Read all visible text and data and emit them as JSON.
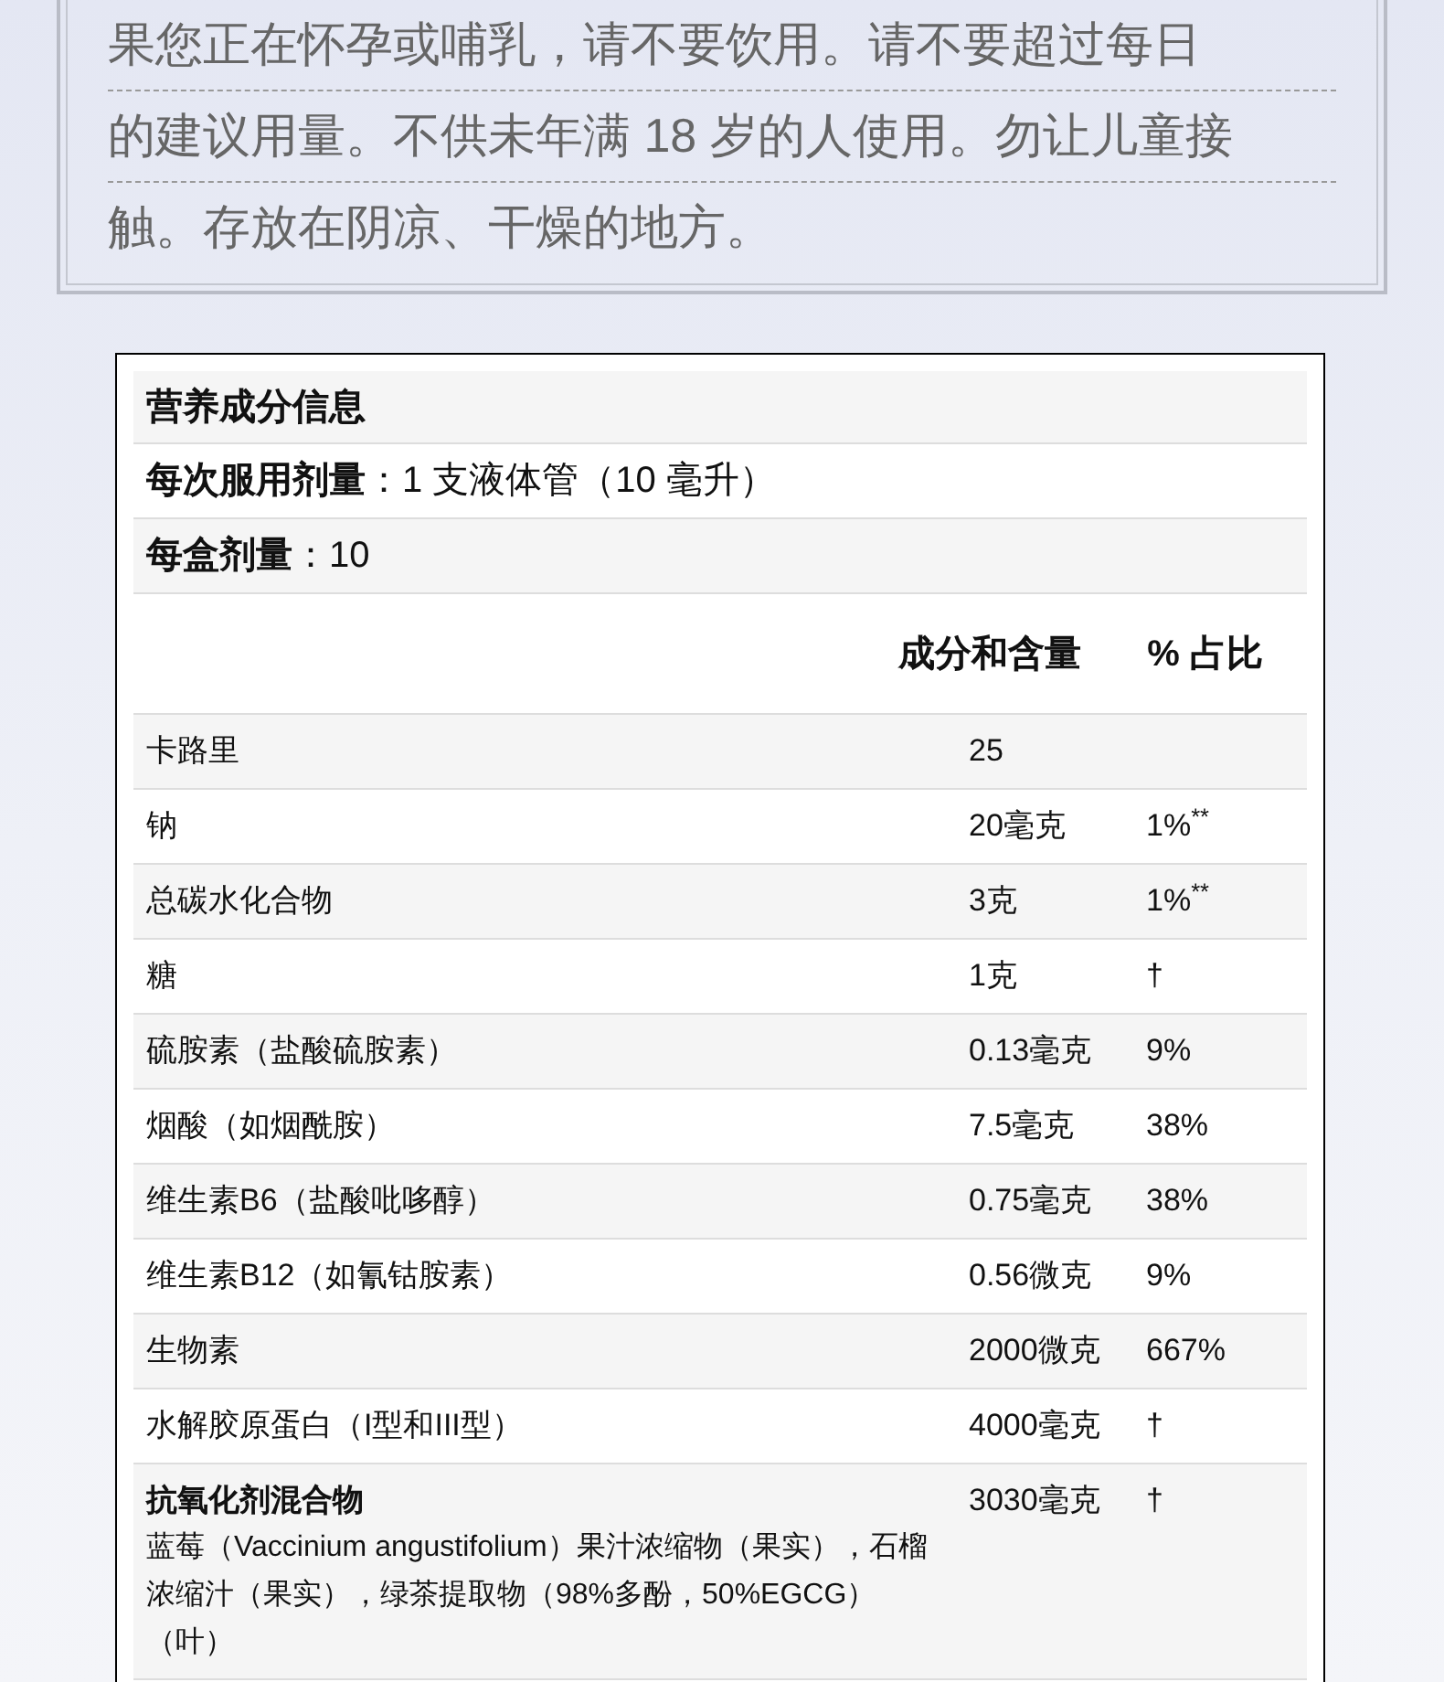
{
  "warning_lines": [
    "果您正在怀孕或哺乳，请不要饮用。请不要超过每日",
    "的建议用量。不供未年满 18 岁的人使用。勿让儿童接",
    "触。存放在阴凉、干燥的地方。"
  ],
  "facts": {
    "title": "营养成分信息",
    "serving_size": "**每次服用剂量**：1 支液体管（10 毫升）",
    "servings_per_box": "**每盒剂量**：10",
    "columns": [
      "成分和含量",
      "% 占比"
    ],
    "rows": [
      {
        "name": "卡路里",
        "amount": "25"
      },
      {
        "name": "钠",
        "amount": "20毫克",
        "percent": "1%$^{**}$"
      },
      {
        "name": "总碳水化合物",
        "amount": "3克",
        "percent": "1%$^{**}$"
      },
      {
        "name": "糖",
        "amount": "1克",
        "percent": "†"
      },
      {
        "name": "硫胺素（盐酸硫胺素）",
        "amount": "0.13毫克",
        "percent": "9%"
      },
      {
        "name": "烟酸（如烟酰胺）",
        "amount": "7.5毫克",
        "percent": "38%"
      },
      {
        "name": "维生素B6（盐酸吡哆醇）",
        "amount": "0.75毫克",
        "percent": "38%"
      },
      {
        "name": "维生素B12（如氰钴胺素）",
        "amount": "0.56微克",
        "percent": "9%"
      },
      {
        "name": "生物素",
        "amount": "2000微克",
        "percent": "667%"
      },
      {
        "name": "水解胶原蛋白（I型和III型）",
        "amount": "4000毫克",
        "percent": "†"
      },
      {
        "name": "抗氧化剂混合物",
        "description": "蓝莓（Vaccinium angustifolium）果汁浓缩物（果实），石榴浓缩汁（果实），绿茶提取物（98%多酚，50%EGCG）（叶）",
        "amount": "3030毫克",
        "percent": "†"
      }
    ]
  }
}
